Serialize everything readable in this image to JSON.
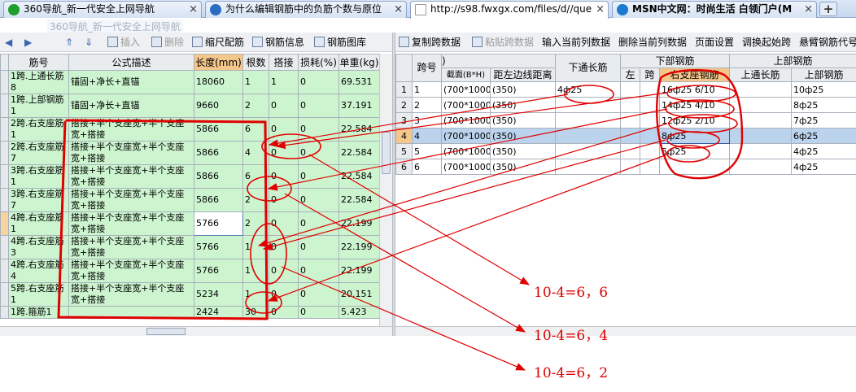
{
  "browser": {
    "tabs": [
      {
        "title": "360导航_新一代安全上网导航",
        "icon_color": "#1e9e2c"
      },
      {
        "title": "为什么编辑钢筋中的负筋个数与原位",
        "icon_color": "#2b6cc4"
      },
      {
        "title": "http://s98.fwxgx.com/files/d//que",
        "icon_color": "#ffffff"
      },
      {
        "title": "MSN中文网：时尚生活 白领门户(M",
        "icon_color": "#1a7bd1"
      }
    ],
    "new_tab": "+",
    "drag_ghost": "360导航_新一代安全上网导航"
  },
  "left_toolbar": {
    "insert": "插入",
    "delete": "删除",
    "scale": "缩尺配筋",
    "rebar_info": "钢筋信息",
    "rebar_lib": "钢筋图库"
  },
  "right_toolbar": {
    "copy_span": "复制跨数据",
    "paste_span": "粘贴跨数据",
    "input_col": "输入当前列数据",
    "delete_col": "删除当前列数据",
    "page_setup": "页面设置",
    "swap_start": "调换起始跨",
    "cantilever": "悬臂钢筋代号"
  },
  "left_table": {
    "headers": [
      "",
      "筋号",
      "公式描述",
      "长度(mm)",
      "根数",
      "搭接",
      "损耗(%)",
      "单重(kg)"
    ],
    "rows": [
      {
        "rn": "",
        "id": "1跨.上通长筋8",
        "formula": "锚固+净长+直锚",
        "length": "18060",
        "count": "1",
        "lap": "1",
        "loss": "0",
        "weight": "69.531"
      },
      {
        "rn": "",
        "id": "1跨.上部钢筋1",
        "formula": "锚固+净长+直锚",
        "length": "9660",
        "count": "2",
        "lap": "0",
        "loss": "0",
        "weight": "37.191"
      },
      {
        "rn": "",
        "id": "2跨.右支座筋1",
        "formula": "搭接+半个支座宽+半个支座宽+搭接",
        "length": "5866",
        "count": "6",
        "lap": "0",
        "loss": "0",
        "weight": "22.584"
      },
      {
        "rn": "",
        "id": "2跨.右支座筋7",
        "formula": "搭接+半个支座宽+半个支座宽+搭接",
        "length": "5866",
        "count": "4",
        "lap": "0",
        "loss": "0",
        "weight": "22.584"
      },
      {
        "rn": "",
        "id": "3跨.右支座筋1",
        "formula": "搭接+半个支座宽+半个支座宽+搭接",
        "length": "5866",
        "count": "6",
        "lap": "0",
        "loss": "0",
        "weight": "22.584"
      },
      {
        "rn": "",
        "id": "3跨.右支座筋7",
        "formula": "搭接+半个支座宽+半个支座宽+搭接",
        "length": "5866",
        "count": "2",
        "lap": "0",
        "loss": "0",
        "weight": "22.584"
      },
      {
        "rn": "",
        "id": "4跨.右支座筋1",
        "formula": "搭接+半个支座宽+半个支座宽+搭接",
        "length": "5766",
        "count": "2",
        "lap": "0",
        "loss": "0",
        "weight": "22.199"
      },
      {
        "rn": "",
        "id": "4跨.右支座筋3",
        "formula": "搭接+半个支座宽+半个支座宽+搭接",
        "length": "5766",
        "count": "1",
        "lap": "0",
        "loss": "0",
        "weight": "22.199"
      },
      {
        "rn": "",
        "id": "4跨.右支座筋4",
        "formula": "搭接+半个支座宽+半个支座宽+搭接",
        "length": "5766",
        "count": "1",
        "lap": "0",
        "loss": "0",
        "weight": "22.199"
      },
      {
        "rn": "",
        "id": "5跨.右支座筋1",
        "formula": "搭接+半个支座宽+半个支座宽+搭接",
        "length": "5234",
        "count": "1",
        "lap": "0",
        "loss": "0",
        "weight": "20.151"
      },
      {
        "rn": "",
        "id": "1跨.箍筋1",
        "formula": "",
        "length": "2424",
        "count": "30",
        "lap": "0",
        "loss": "0",
        "weight": "5.423"
      }
    ]
  },
  "right_table": {
    "header_top": {
      "span": "跨号",
      "lower_through": "下通长筋",
      "lower": "下部钢筋",
      "upper": "上部钢筋"
    },
    "header_sub": {
      "section": "截面(B*H)",
      "dist": "距左边线距离",
      "left": "左",
      "span_col": "跨",
      "support": "右支座钢筋",
      "upper_through": "上通长筋",
      "upper_rebar": "上部钢筋"
    },
    "rows": [
      {
        "rn": "1",
        "span": "1",
        "section": "(700*1000",
        "dist": "(350)",
        "lower_through": "4ф25",
        "right_support": "16ф25 6/10",
        "upper_through": "",
        "upper": "10ф25"
      },
      {
        "rn": "2",
        "span": "2",
        "section": "(700*1000",
        "dist": "(350)",
        "lower_through": "",
        "right_support": "14ф25 4/10",
        "upper_through": "",
        "upper": "8ф25"
      },
      {
        "rn": "3",
        "span": "3",
        "section": "(700*1000",
        "dist": "(350)",
        "lower_through": "",
        "right_support": "12ф25 2/10",
        "upper_through": "",
        "upper": "7ф25"
      },
      {
        "rn": "4",
        "span": "4",
        "section": "(700*1000",
        "dist": "(350)",
        "lower_through": "",
        "right_support": "8ф25",
        "upper_through": "",
        "upper": "6ф25"
      },
      {
        "rn": "5",
        "span": "5",
        "section": "(700*1000",
        "dist": "(350)",
        "lower_through": "",
        "right_support": "5ф25",
        "upper_through": "",
        "upper": "4ф25"
      },
      {
        "rn": "6",
        "span": "6",
        "section": "(700*1000",
        "dist": "(350)",
        "lower_through": "",
        "right_support": "",
        "upper_through": "",
        "upper": "4ф25"
      }
    ]
  },
  "annotations": {
    "note1": "10-4=6，6",
    "note2": "10-4=6，4",
    "note3": "10-4=6，2",
    "color": "#e00000"
  }
}
